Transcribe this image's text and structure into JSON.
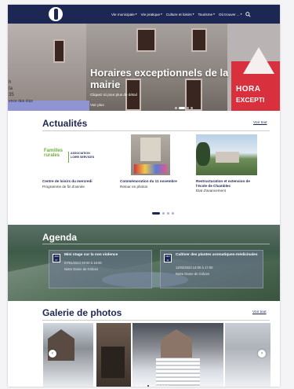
{
  "nav": {
    "items": [
      {
        "label": "Vie municipale",
        "caret": "▾"
      },
      {
        "label": "Vie pratique",
        "caret": "▾"
      },
      {
        "label": "Culture et loisirs",
        "caret": "▾"
      },
      {
        "label": "Tourisme",
        "caret": "▾"
      },
      {
        "label": "Où trouver ...",
        "caret": "▾"
      }
    ],
    "search_icon": "search-icon"
  },
  "hero": {
    "title": "Horaires exceptionnels de la mairie",
    "subtitle": "Cliquez ici pour plus de détail",
    "more": "Voir plus",
    "sign_text_1": "HORA",
    "sign_text_2": "EXCEPTI",
    "side_text_1": "h",
    "side_text_2": "ta",
    "side_text_3": "35",
    "side_text_4": "ence des élus",
    "slides": 4,
    "active_slide": 1
  },
  "actualites": {
    "title": "Actualités",
    "voir_tout": "Voir tout",
    "cards": [
      {
        "title": "Centre de loisirs du mercredi",
        "subtitle": "Programme de fin d'année",
        "logo_text_1": "Familles",
        "logo_text_2": "rurales",
        "logo_text_3": "ASSOCIATION",
        "logo_text_4": "LOIRE SERVICES"
      },
      {
        "title": "Commémoration du 11 novembre",
        "subtitle": "Retour en photos"
      },
      {
        "title": "Restructuration et extension de l'école de Chambles",
        "subtitle": "Etat d'avancement"
      }
    ],
    "pager": 4,
    "active_page": 0
  },
  "agenda": {
    "title": "Agenda",
    "events": [
      {
        "day_label": "JAN",
        "day": "07",
        "title": "Mini stage sur la non violence",
        "date": "07/01/2023 09:00 à 16:00",
        "location": "Notre Dame de Grâces"
      },
      {
        "day_label": "FEV",
        "day": "11",
        "title": "Cultiver des plantes aromatiques-médicinales",
        "date": "11/02/2023 14:00 à 17:00",
        "location": "Notre Dame de Grâces"
      }
    ]
  },
  "galerie": {
    "title": "Galerie de photos",
    "voir_tout": "Voir tout",
    "prev": "‹",
    "next": "›",
    "dots": 12,
    "active_dot": 4
  },
  "colors": {
    "navy": "#1d2754",
    "red_sign": "#d9303d",
    "green": "#6fae3b"
  }
}
